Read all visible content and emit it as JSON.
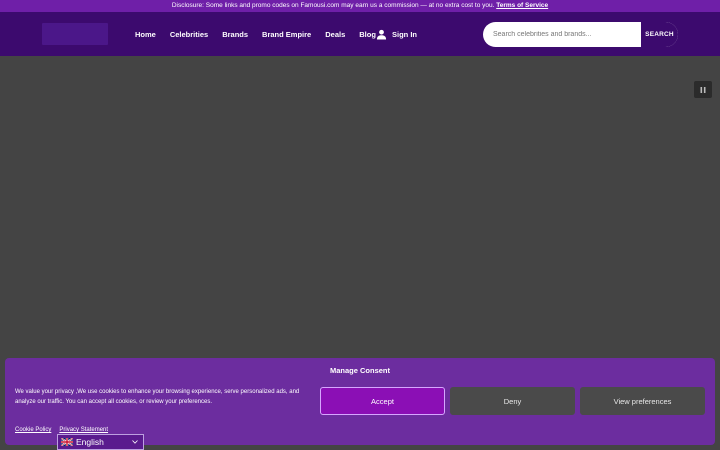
{
  "disclosure": {
    "text": "Disclosure: Some links and promo codes on Famousi.com may earn us a commission — at no extra cost to you.",
    "terms_link": "Terms of Service"
  },
  "header": {
    "nav": [
      "Home",
      "Celebrities",
      "Brands",
      "Brand Empire",
      "Deals",
      "Blog"
    ],
    "signin_label": "Sign In",
    "search": {
      "placeholder": "Search celebrities and brands...",
      "value": "",
      "button_label": "SEARCH"
    }
  },
  "icons": {
    "user": "user-icon",
    "pause": "pause-icon",
    "flag": "uk-flag-icon",
    "chevron": "chevron-down-icon"
  },
  "consent": {
    "title": "Manage Consent",
    "text": "We value your privacy ,We use cookies to enhance your browsing experience, serve personalized ads, and analyze our traffic. You can accept all cookies, or review your preferences.",
    "accept_label": "Accept",
    "deny_label": "Deny",
    "preferences_label": "View preferences",
    "cookie_policy_label": "Cookie Policy",
    "privacy_statement_label": "Privacy Statement"
  },
  "language": {
    "selected": "English"
  },
  "colors": {
    "topbar": "#6f1fa8",
    "header": "#3c0a6e",
    "consent_panel": "#6c2d9f",
    "accept": "#8b0fb5",
    "page_overlay": "#444444"
  }
}
